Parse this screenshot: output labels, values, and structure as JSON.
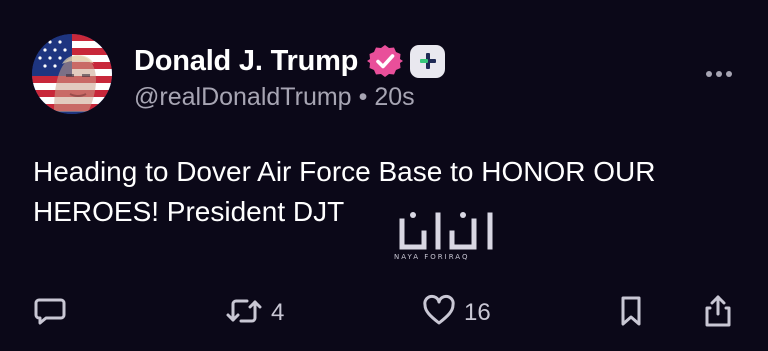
{
  "post": {
    "display_name": "Donald J. Trump",
    "handle": "@realDonaldTrump",
    "separator": "•",
    "timestamp": "20s",
    "text": "Heading to Dover Air Force Base to HONOR OUR HEROES! President DJT",
    "avatar_icon": "flag-portrait-avatar",
    "verified_icon": "verified-badge-icon",
    "verified_color": "#e94f9a",
    "plus_icon": "plus-badge-icon"
  },
  "actions": {
    "reply_icon": "reply-icon",
    "repost_icon": "repost-icon",
    "repost_count": "4",
    "like_icon": "heart-icon",
    "like_count": "16",
    "bookmark_icon": "bookmark-icon",
    "share_icon": "share-icon"
  },
  "watermark": {
    "logo_text": "نايا",
    "caption": "NAYA FORIRAQ"
  },
  "colors": {
    "background": "#0b0818",
    "text_primary": "#ffffff",
    "text_secondary": "#a7a5b3",
    "icon": "#c9c7d4"
  }
}
